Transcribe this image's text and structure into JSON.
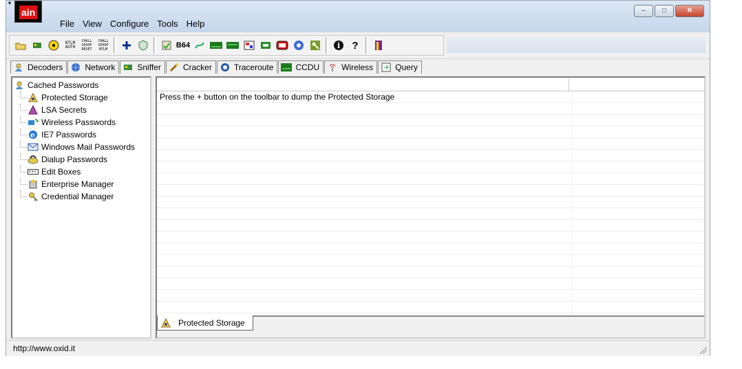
{
  "app": {
    "logo_text": "ain",
    "window_buttons": {
      "minimize": "–",
      "maximize": "□",
      "close": "✕"
    }
  },
  "menu": [
    "File",
    "View",
    "Configure",
    "Tools",
    "Help"
  ],
  "toolbar": {
    "buttons": [
      "open-folder",
      "network-card",
      "radiation",
      "ntlm-auth",
      "chall-spoof-reset",
      "chall-spoof-ntlm",
      "add",
      "shield",
      "decode",
      "base64",
      "route",
      "cisco",
      "vpn",
      "vnc",
      "lsa",
      "ccdu",
      "wireless",
      "key",
      "about",
      "help",
      "exit"
    ],
    "labels": {
      "ntlm": "NTLM AUTH",
      "chall1": "CHALL SPOOF RESET",
      "chall2": "CHALL SPOOF NTLM",
      "b64": "B64"
    }
  },
  "tabs": [
    {
      "label": "Decoders",
      "icon": "decoders-icon"
    },
    {
      "label": "Network",
      "icon": "network-icon"
    },
    {
      "label": "Sniffer",
      "icon": "sniffer-icon"
    },
    {
      "label": "Cracker",
      "icon": "cracker-icon"
    },
    {
      "label": "Traceroute",
      "icon": "traceroute-icon"
    },
    {
      "label": "CCDU",
      "icon": "ccdu-icon"
    },
    {
      "label": "Wireless",
      "icon": "wireless-icon"
    },
    {
      "label": "Query",
      "icon": "query-icon"
    }
  ],
  "tree": {
    "root": "Cached Passwords",
    "items": [
      "Protected Storage",
      "LSA Secrets",
      "Wireless Passwords",
      "IE7 Passwords",
      "Windows Mail Passwords",
      "Dialup Passwords",
      "Edit Boxes",
      "Enterprise Manager",
      "Credential Manager"
    ]
  },
  "list": {
    "message": "Press the + button on the toolbar to dump the Protected Storage"
  },
  "bottom_tab": {
    "label": "Protected Storage"
  },
  "status": {
    "url": "http://www.oxid.it"
  },
  "colors": {
    "accent_red": "#d11111",
    "title_gradient": "#c6d6ea"
  }
}
